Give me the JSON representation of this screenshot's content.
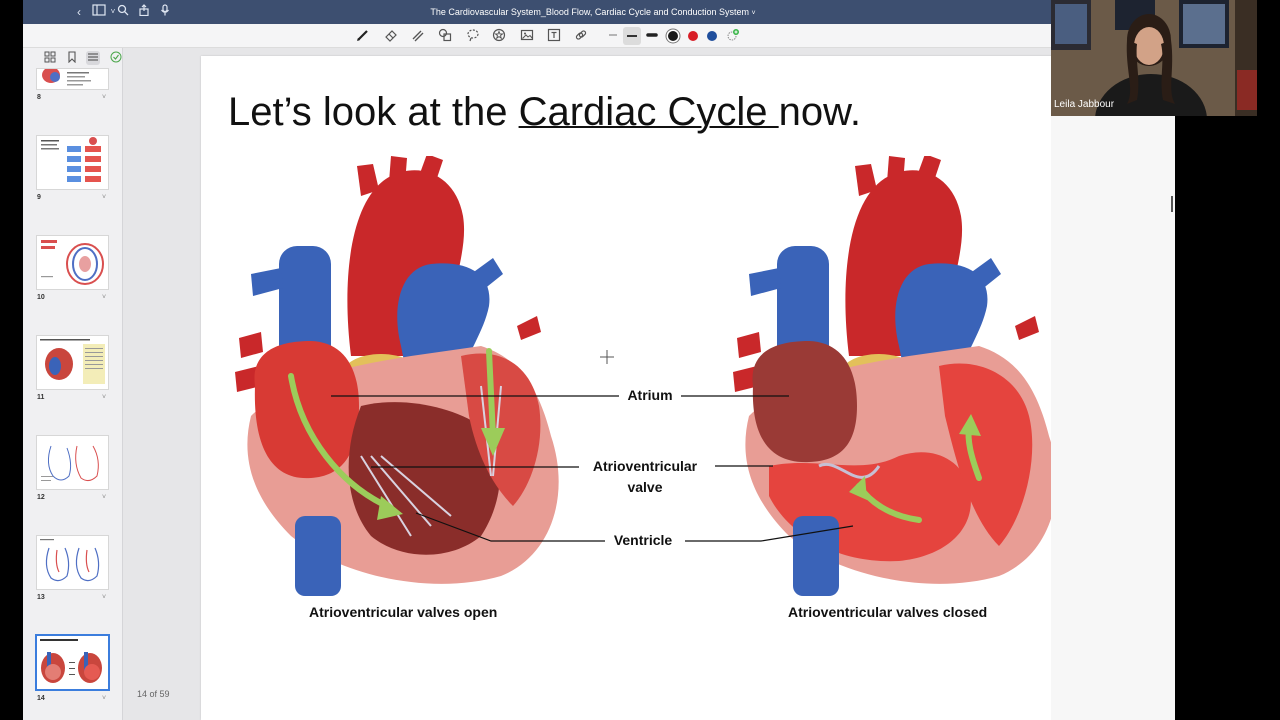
{
  "window": {
    "title": "The Cardiovascular System_Blood Flow, Cardiac Cycle and Conduction System",
    "title_chevron": "˅"
  },
  "toolbar": {
    "icons": [
      "pen-icon",
      "eraser-icon",
      "highlighter-icon",
      "shapes-icon",
      "lasso-icon",
      "star-icon",
      "image-icon",
      "text-icon",
      "link-icon"
    ],
    "colors": [
      "#1a1a1a",
      "#d81e27",
      "#1f4e9c"
    ]
  },
  "sidebar": {
    "thumbnails": [
      {
        "num": "8"
      },
      {
        "num": "9"
      },
      {
        "num": "10"
      },
      {
        "num": "11"
      },
      {
        "num": "12"
      },
      {
        "num": "13"
      },
      {
        "num": "14"
      }
    ],
    "page_counter": "14 of 59"
  },
  "slide": {
    "title_part1": "Let’s look at the ",
    "title_underlined": "Cardiac Cycle ",
    "title_part2": "now.",
    "labels": {
      "atrium": "Atrium",
      "av_valve_line1": "Atrioventricular",
      "av_valve_line2": "valve",
      "ventricle": "Ventricle"
    },
    "captions": {
      "left": "Atrioventricular valves open",
      "right": "Atrioventricular valves closed"
    }
  },
  "video": {
    "speaker": "Leila Jabbour"
  },
  "colors": {
    "titlebar": "#3d4f70",
    "vein_blue": "#3a63b8",
    "artery_red": "#d32a2a",
    "muscle_pink": "#e89d95",
    "flow_green": "#9ccc5a"
  }
}
